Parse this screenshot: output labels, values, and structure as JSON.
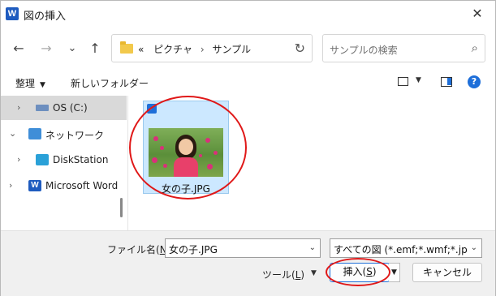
{
  "window": {
    "title": "図の挿入",
    "app_icon": "word-icon",
    "close_glyph": "✕"
  },
  "nav": {
    "back_glyph": "←",
    "forward_glyph": "→",
    "recent_glyph": "⌄",
    "up_glyph": "↑",
    "address": {
      "prefix": "«",
      "crumbs": [
        "ピクチャ",
        "サンプル"
      ],
      "separator": "›"
    },
    "refresh_glyph": "↻",
    "search": {
      "placeholder": "サンプルの検索",
      "icon_glyph": "⌕"
    }
  },
  "commandbar": {
    "organize": "整理",
    "new_folder": "新しいフォルダー",
    "help_glyph": "?"
  },
  "tree": {
    "items": [
      {
        "label": "OS (C:)",
        "icon": "drive-icon",
        "selected": true
      },
      {
        "label": "ネットワーク",
        "icon": "network-icon",
        "expanded": true
      },
      {
        "label": "DiskStation",
        "icon": "nas-icon"
      },
      {
        "label": "Microsoft Word",
        "icon": "word-icon",
        "icon_text": "W"
      }
    ],
    "expand_glyph": "›",
    "collapse_glyph": "⌄"
  },
  "files": [
    {
      "name": "女の子.JPG",
      "selected": true,
      "check_glyph": "✓"
    }
  ],
  "footer": {
    "filename_label": "ファイル名(",
    "filename_key": "N",
    "filename_label_end": "):",
    "filename_value": "女の子.JPG",
    "filetype_value": "すべての図 (*.emf;*.wmf;*.jpg;*.jpeg",
    "tools_label": "ツール(",
    "tools_key": "L",
    "tools_label_end": ")",
    "insert_label": "挿入(",
    "insert_key": "S",
    "insert_label_end": ")",
    "cancel_label": "キャンセル",
    "dropdown_glyph": "⌄",
    "caret_glyph": "▼"
  },
  "colors": {
    "accent": "#1e6fd9",
    "selection": "#cce8ff",
    "annotation_ring": "#e01818",
    "footer_bg": "#f0f0f0"
  }
}
